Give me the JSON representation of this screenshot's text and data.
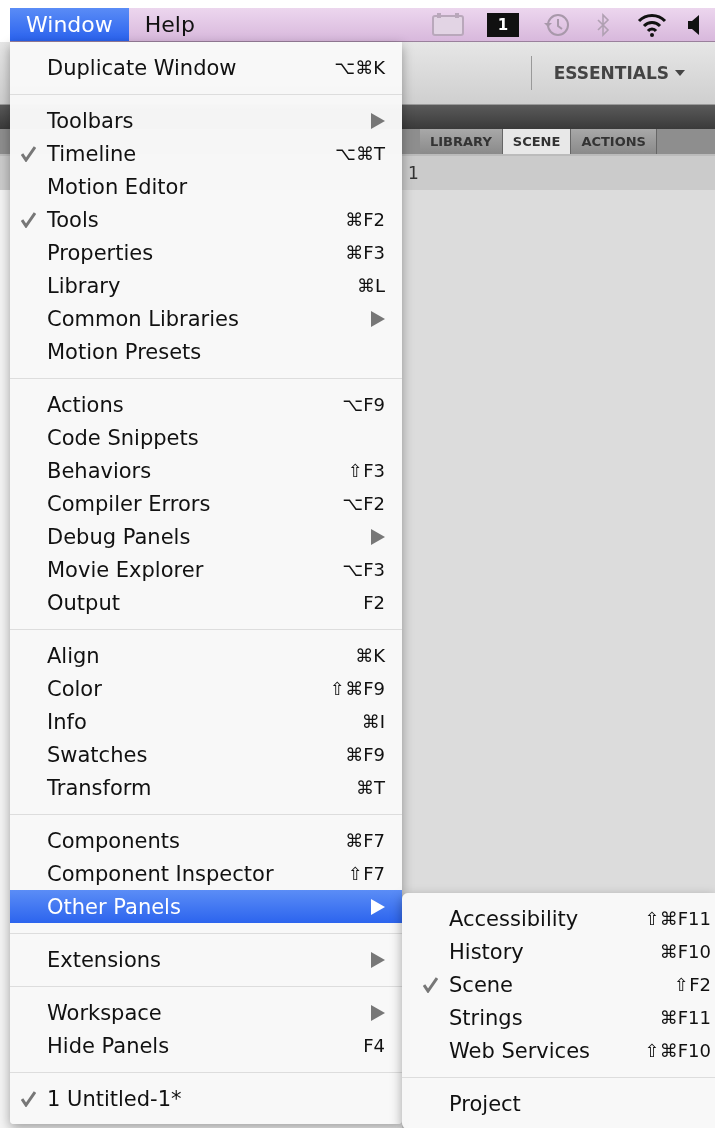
{
  "menubar": {
    "items": [
      {
        "label": "Window",
        "selected": true
      },
      {
        "label": "Help",
        "selected": false
      }
    ],
    "spaces_indicator": "1"
  },
  "app": {
    "workspace_button": "ESSENTIALS",
    "tabs": [
      {
        "label": "LIBRARY",
        "selected": false
      },
      {
        "label": "SCENE",
        "selected": true
      },
      {
        "label": "ACTIONS",
        "selected": false
      }
    ],
    "scene_row": "1"
  },
  "menu": {
    "items": [
      {
        "kind": "item",
        "label": "Duplicate Window",
        "shortcut": "⌥⌘K",
        "checked": false,
        "has_submenu": false,
        "selected": false
      },
      {
        "kind": "separator"
      },
      {
        "kind": "item",
        "label": "Toolbars",
        "checked": false,
        "has_submenu": true,
        "selected": false
      },
      {
        "kind": "item",
        "label": "Timeline",
        "shortcut": "⌥⌘T",
        "checked": true,
        "has_submenu": false,
        "selected": false
      },
      {
        "kind": "item",
        "label": "Motion Editor",
        "checked": false,
        "has_submenu": false,
        "selected": false
      },
      {
        "kind": "item",
        "label": "Tools",
        "shortcut": "⌘F2",
        "checked": true,
        "has_submenu": false,
        "selected": false
      },
      {
        "kind": "item",
        "label": "Properties",
        "shortcut": "⌘F3",
        "checked": false,
        "has_submenu": false,
        "selected": false
      },
      {
        "kind": "item",
        "label": "Library",
        "shortcut": "⌘L",
        "checked": false,
        "has_submenu": false,
        "selected": false
      },
      {
        "kind": "item",
        "label": "Common Libraries",
        "checked": false,
        "has_submenu": true,
        "selected": false
      },
      {
        "kind": "item",
        "label": "Motion Presets",
        "checked": false,
        "has_submenu": false,
        "selected": false
      },
      {
        "kind": "separator"
      },
      {
        "kind": "item",
        "label": "Actions",
        "shortcut": "⌥F9",
        "checked": false,
        "has_submenu": false,
        "selected": false
      },
      {
        "kind": "item",
        "label": "Code Snippets",
        "checked": false,
        "has_submenu": false,
        "selected": false
      },
      {
        "kind": "item",
        "label": "Behaviors",
        "shortcut": "⇧F3",
        "checked": false,
        "has_submenu": false,
        "selected": false
      },
      {
        "kind": "item",
        "label": "Compiler Errors",
        "shortcut": "⌥F2",
        "checked": false,
        "has_submenu": false,
        "selected": false
      },
      {
        "kind": "item",
        "label": "Debug Panels",
        "checked": false,
        "has_submenu": true,
        "selected": false
      },
      {
        "kind": "item",
        "label": "Movie Explorer",
        "shortcut": "⌥F3",
        "checked": false,
        "has_submenu": false,
        "selected": false
      },
      {
        "kind": "item",
        "label": "Output",
        "shortcut": "F2",
        "checked": false,
        "has_submenu": false,
        "selected": false
      },
      {
        "kind": "separator"
      },
      {
        "kind": "item",
        "label": "Align",
        "shortcut": "⌘K",
        "checked": false,
        "has_submenu": false,
        "selected": false
      },
      {
        "kind": "item",
        "label": "Color",
        "shortcut": "⇧⌘F9",
        "checked": false,
        "has_submenu": false,
        "selected": false
      },
      {
        "kind": "item",
        "label": "Info",
        "shortcut": "⌘I",
        "checked": false,
        "has_submenu": false,
        "selected": false
      },
      {
        "kind": "item",
        "label": "Swatches",
        "shortcut": "⌘F9",
        "checked": false,
        "has_submenu": false,
        "selected": false
      },
      {
        "kind": "item",
        "label": "Transform",
        "shortcut": "⌘T",
        "checked": false,
        "has_submenu": false,
        "selected": false
      },
      {
        "kind": "separator"
      },
      {
        "kind": "item",
        "label": "Components",
        "shortcut": "⌘F7",
        "checked": false,
        "has_submenu": false,
        "selected": false
      },
      {
        "kind": "item",
        "label": "Component Inspector",
        "shortcut": "⇧F7",
        "checked": false,
        "has_submenu": false,
        "selected": false
      },
      {
        "kind": "item",
        "label": "Other Panels",
        "checked": false,
        "has_submenu": true,
        "selected": true
      },
      {
        "kind": "separator"
      },
      {
        "kind": "item",
        "label": "Extensions",
        "checked": false,
        "has_submenu": true,
        "selected": false
      },
      {
        "kind": "separator"
      },
      {
        "kind": "item",
        "label": "Workspace",
        "checked": false,
        "has_submenu": true,
        "selected": false
      },
      {
        "kind": "item",
        "label": "Hide Panels",
        "shortcut": "F4",
        "checked": false,
        "has_submenu": false,
        "selected": false
      },
      {
        "kind": "separator"
      },
      {
        "kind": "item",
        "label": "1 Untitled-1*",
        "checked": true,
        "has_submenu": false,
        "selected": false
      }
    ]
  },
  "submenu": {
    "items": [
      {
        "kind": "item",
        "label": "Accessibility",
        "shortcut": "⇧⌘F11",
        "checked": false,
        "has_submenu": false,
        "selected": false
      },
      {
        "kind": "item",
        "label": "History",
        "shortcut": "⌘F10",
        "checked": false,
        "has_submenu": false,
        "selected": false
      },
      {
        "kind": "item",
        "label": "Scene",
        "shortcut": "⇧F2",
        "checked": true,
        "has_submenu": false,
        "selected": false
      },
      {
        "kind": "item",
        "label": "Strings",
        "shortcut": "⌘F11",
        "checked": false,
        "has_submenu": false,
        "selected": false
      },
      {
        "kind": "item",
        "label": "Web Services",
        "shortcut": "⇧⌘F10",
        "checked": false,
        "has_submenu": false,
        "selected": false
      },
      {
        "kind": "separator"
      },
      {
        "kind": "item",
        "label": "Project",
        "checked": false,
        "has_submenu": false,
        "selected": false
      }
    ]
  }
}
